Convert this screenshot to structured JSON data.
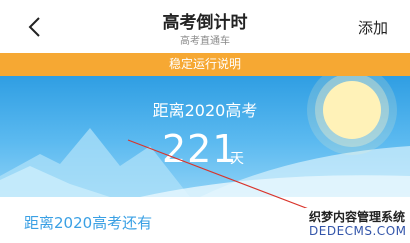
{
  "header": {
    "title": "高考倒计时",
    "subtitle": "高考直通车",
    "add_label": "添加",
    "back_icon": "chevron-left-icon"
  },
  "notice": {
    "text": "稳定运行说明"
  },
  "countdown": {
    "target_label": "距离2020高考",
    "days_value": "221",
    "days_unit": "天"
  },
  "section": {
    "title": "距离2020高考还有"
  },
  "watermark": {
    "line1": "织梦内容管理系统",
    "line2": "DEDECMS.COM"
  },
  "colors": {
    "notice_bg": "#f6a833",
    "banner_top": "#2f9ee3",
    "accent_text": "#3aa0e4",
    "annotation_line": "#d9342b"
  }
}
